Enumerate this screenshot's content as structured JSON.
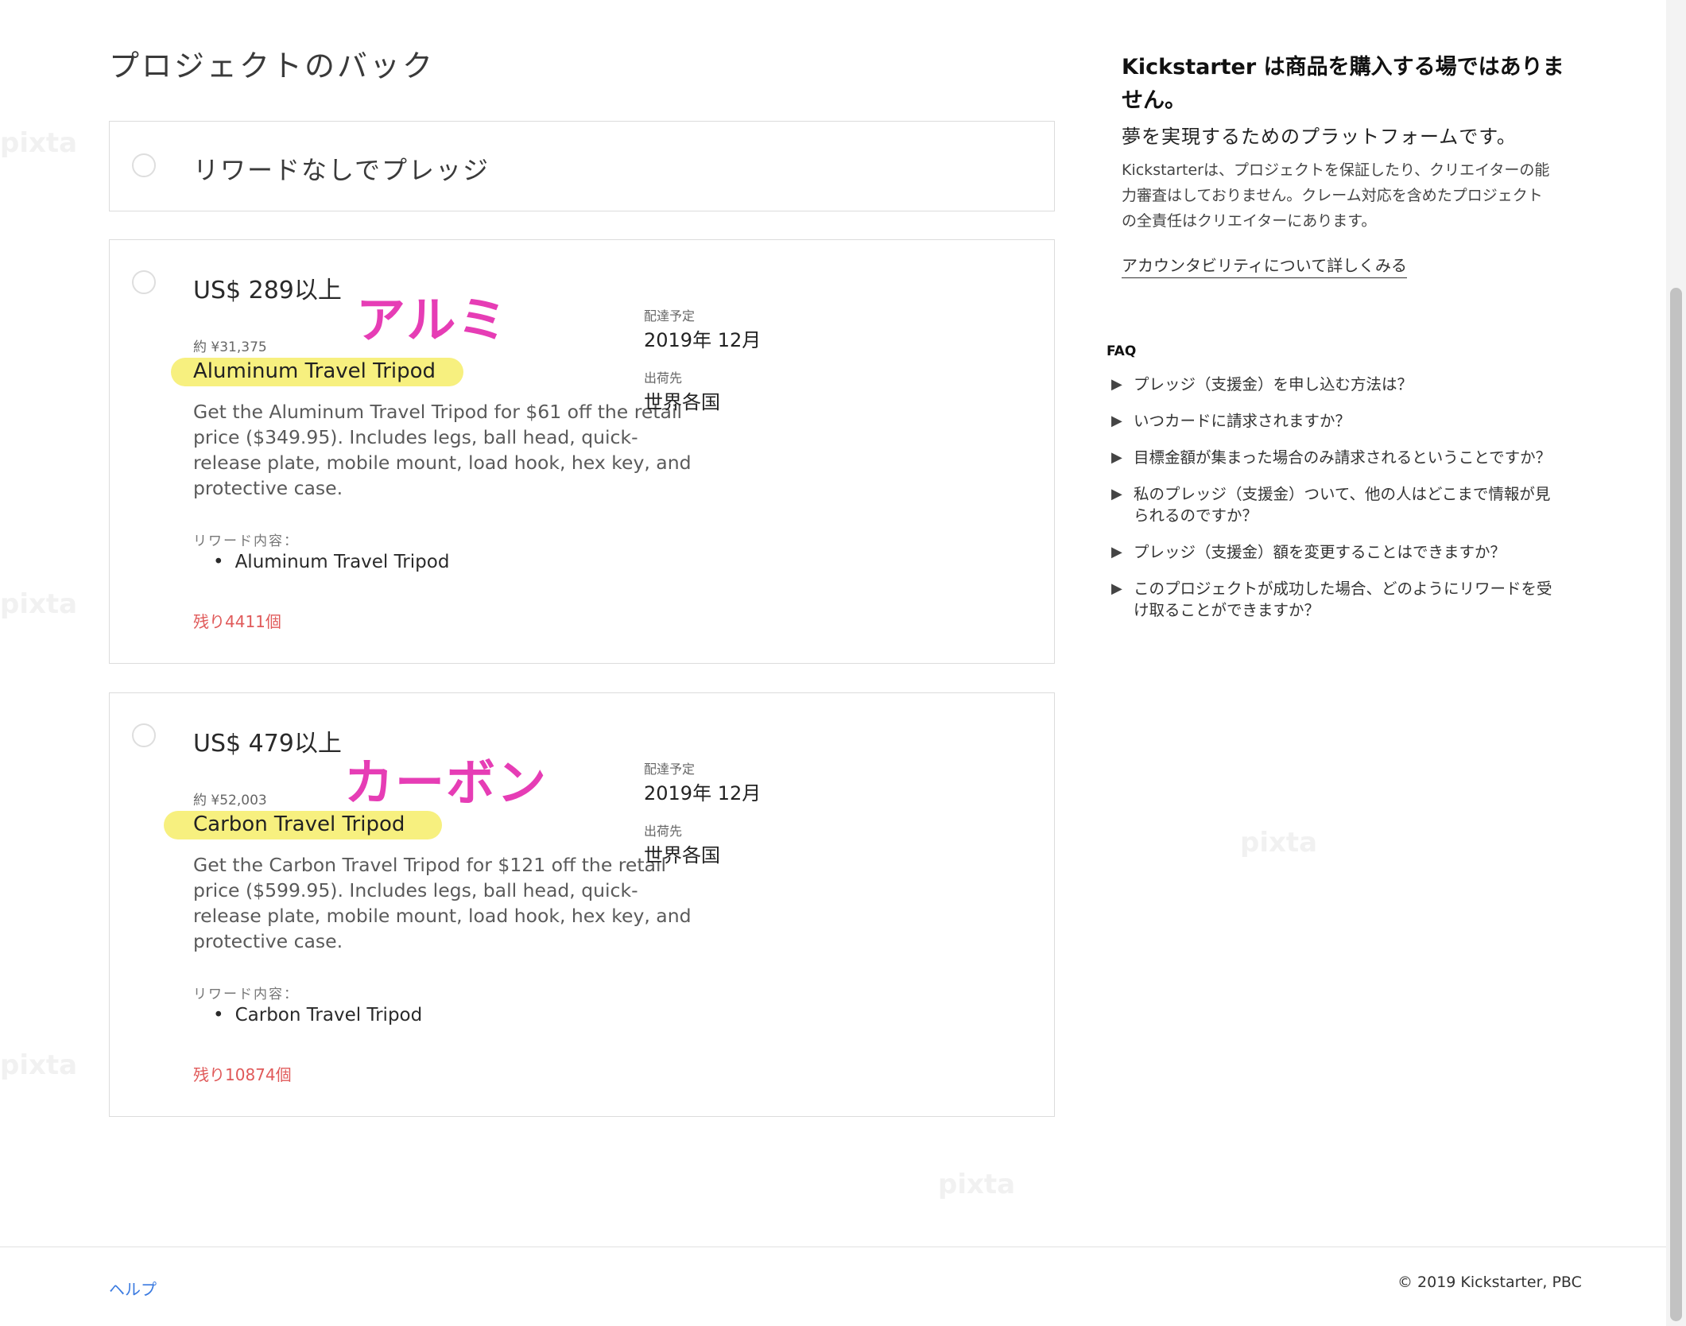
{
  "page": {
    "title": "プロジェクトのバック"
  },
  "no_reward": {
    "label": "リワードなしでプレッジ"
  },
  "rewards": [
    {
      "price": "US$ 289以上",
      "approx": "約 ¥31,375",
      "name": "Aluminum Travel Tripod",
      "description": "Get the Aluminum Travel Tripod for $61 off the retail price ($349.95). Includes legs, ball head, quick-release plate, mobile mount, load hook, hex key, and protective case.",
      "includes_label": "リワード内容：",
      "includes": [
        "Aluminum Travel Tripod"
      ],
      "remaining": "残り4411個",
      "delivery_label": "配達予定",
      "delivery_value": "2019年 12月",
      "ships_label": "出荷先",
      "ships_value": "世界各国",
      "annotation": "アルミ"
    },
    {
      "price": "US$ 479以上",
      "approx": "約 ¥52,003",
      "name": "Carbon Travel Tripod",
      "description": "Get the Carbon Travel Tripod for $121 off the retail price ($599.95). Includes legs, ball head, quick-release plate, mobile mount, load hook, hex key, and protective case.",
      "includes_label": "リワード内容：",
      "includes": [
        "Carbon Travel Tripod"
      ],
      "remaining": "残り10874個",
      "delivery_label": "配達予定",
      "delivery_value": "2019年 12月",
      "ships_label": "出荷先",
      "ships_value": "世界各国",
      "annotation": "カーボン"
    }
  ],
  "sidebar": {
    "heading": "Kickstarter は商品を購入する場ではありません。",
    "subheading": "夢を実現するためのプラットフォームです。",
    "body": "Kickstarterは、プロジェクトを保証したり、クリエイターの能力審査はしておりません。クレーム対応を含めたプロジェクトの全責任はクリエイターにあります。",
    "link": "アカウンタビリティについて詳しくみる",
    "faq_label": "FAQ",
    "faq": [
      "プレッジ（支援金）を申し込む方法は？",
      "いつカードに請求されますか？",
      "目標金額が集まった場合のみ請求されるということですか？",
      "私のプレッジ（支援金）ついて、他の人はどこまで情報が見られるのですか？",
      "プレッジ（支援金）額を変更することはできますか？",
      "このプロジェクトが成功した場合、どのようにリワードを受け取ることができますか？"
    ]
  },
  "footer": {
    "help": "ヘルプ",
    "copyright": "© 2019 Kickstarter, PBC"
  },
  "colors": {
    "highlight": "#f7f07f",
    "annotation": "#e63db5",
    "remaining": "#e05a5a",
    "link": "#3a7ae0"
  }
}
